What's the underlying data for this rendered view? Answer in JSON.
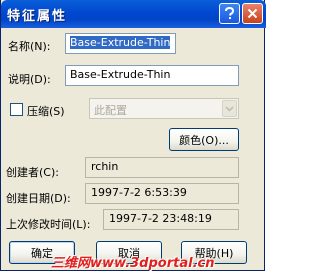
{
  "window": {
    "title": "特征属性",
    "help_icon": "help-icon",
    "close_icon": "close-icon"
  },
  "form": {
    "name_label": "名称",
    "name_mnemonic": "(N):",
    "name_value": "Base-Extrude-Thin",
    "desc_label": "说明",
    "desc_mnemonic": "(D):",
    "desc_value": "Base-Extrude-Thin",
    "compress_label": "压缩",
    "compress_mnemonic": "(S)",
    "compress_checked": false,
    "config_value": "此配置",
    "color_button": "颜色(O)...",
    "creator_label": "创建者",
    "creator_mnemonic": "(C):",
    "creator_value": "rchin",
    "created_label": "创建日期",
    "created_mnemonic": "(D):",
    "created_value": "1997-7-2 6:53:39",
    "modified_label": "上次修改时间",
    "modified_mnemonic": "(L):",
    "modified_value": "1997-7-2 23:48:19"
  },
  "buttons": {
    "ok": "确定",
    "cancel": "取消",
    "help": "帮助(H)"
  },
  "watermark": "三维网www.3dportal.cn",
  "colors": {
    "titlebar": "#0054e3",
    "dialog_bg": "#ece9d8",
    "selection": "#316ac5",
    "watermark": "#e0201e"
  }
}
